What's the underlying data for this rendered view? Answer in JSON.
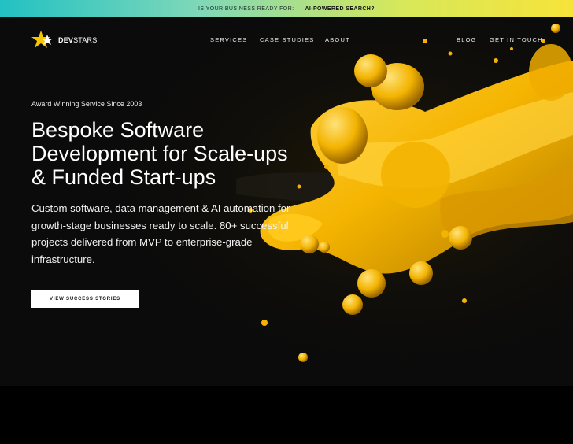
{
  "banner": {
    "prefix": "IS YOUR BUSINESS READY FOR:",
    "highlight": "AI-POWERED SEARCH?"
  },
  "brand": {
    "name_bold": "DEV",
    "name_light": "STARS",
    "logo_icon": "star-icon"
  },
  "nav": {
    "services": "SERVICES",
    "case_studies": "CASE STUDIES",
    "about": "ABOUT",
    "blog": "BLOG",
    "contact": "GET IN TOUCH"
  },
  "hero": {
    "eyebrow": "Award Winning Service Since 2003",
    "headline": "Bespoke Software Development for Scale-ups & Funded Start-ups",
    "subtext": "Custom software, data management & AI automation for growth-stage businesses ready to scale. 80+ successful projects delivered from MVP to enterprise-grade infrastructure.",
    "cta_label": "VIEW SUCCESS STORIES"
  },
  "colors": {
    "accent_gold": "#f5b400",
    "banner_start": "#22c1c3",
    "banner_end": "#f7e33a",
    "background": "#0b0b0b"
  }
}
